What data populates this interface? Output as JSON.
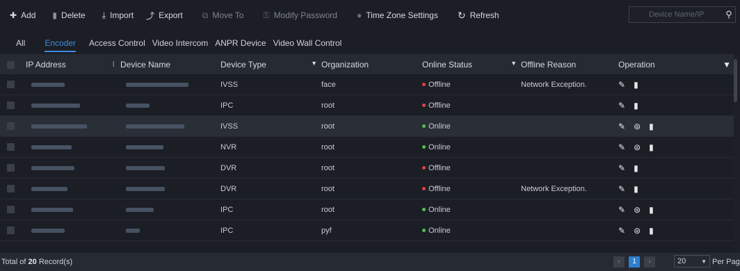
{
  "toolbar": {
    "add": "Add",
    "delete": "Delete",
    "import": "Import",
    "export": "Export",
    "move_to": "Move To",
    "modify_password": "Modify Password",
    "time_zone": "Time Zone Settings",
    "refresh": "Refresh",
    "search_placeholder": "Device Name/IP"
  },
  "tabs": [
    "All",
    "Encoder",
    "Access Control",
    "Video Intercom",
    "ANPR Device",
    "Video Wall Control"
  ],
  "active_tab": "Encoder",
  "columns": {
    "ip": "IP Address",
    "name": "Device Name",
    "type": "Device Type",
    "org": "Organization",
    "status": "Online Status",
    "reason": "Offline Reason",
    "op": "Operation"
  },
  "rows": [
    {
      "type": "IVSS",
      "org": "face",
      "status": "Offline",
      "reason": "Network Exception.",
      "ops": 2
    },
    {
      "type": "IPC",
      "org": "root",
      "status": "Offline",
      "reason": "",
      "ops": 2
    },
    {
      "type": "IVSS",
      "org": "root",
      "status": "Online",
      "reason": "",
      "ops": 3
    },
    {
      "type": "NVR",
      "org": "root",
      "status": "Online",
      "reason": "",
      "ops": 3
    },
    {
      "type": "DVR",
      "org": "root",
      "status": "Offline",
      "reason": "",
      "ops": 2
    },
    {
      "type": "DVR",
      "org": "root",
      "status": "Offline",
      "reason": "Network Exception.",
      "ops": 2
    },
    {
      "type": "IPC",
      "org": "root",
      "status": "Online",
      "reason": "",
      "ops": 3
    },
    {
      "type": "IPC",
      "org": "pyf",
      "status": "Online",
      "reason": "",
      "ops": 3
    }
  ],
  "colors": {
    "offline": "#e0414a",
    "online": "#4cc44c",
    "accent": "#3c8fe0"
  },
  "footer": {
    "total_prefix": "Total of ",
    "total_count": "20",
    "total_suffix": " Record(s)",
    "page": "1",
    "per_page_value": "20",
    "per_page_label": "Per Page"
  }
}
